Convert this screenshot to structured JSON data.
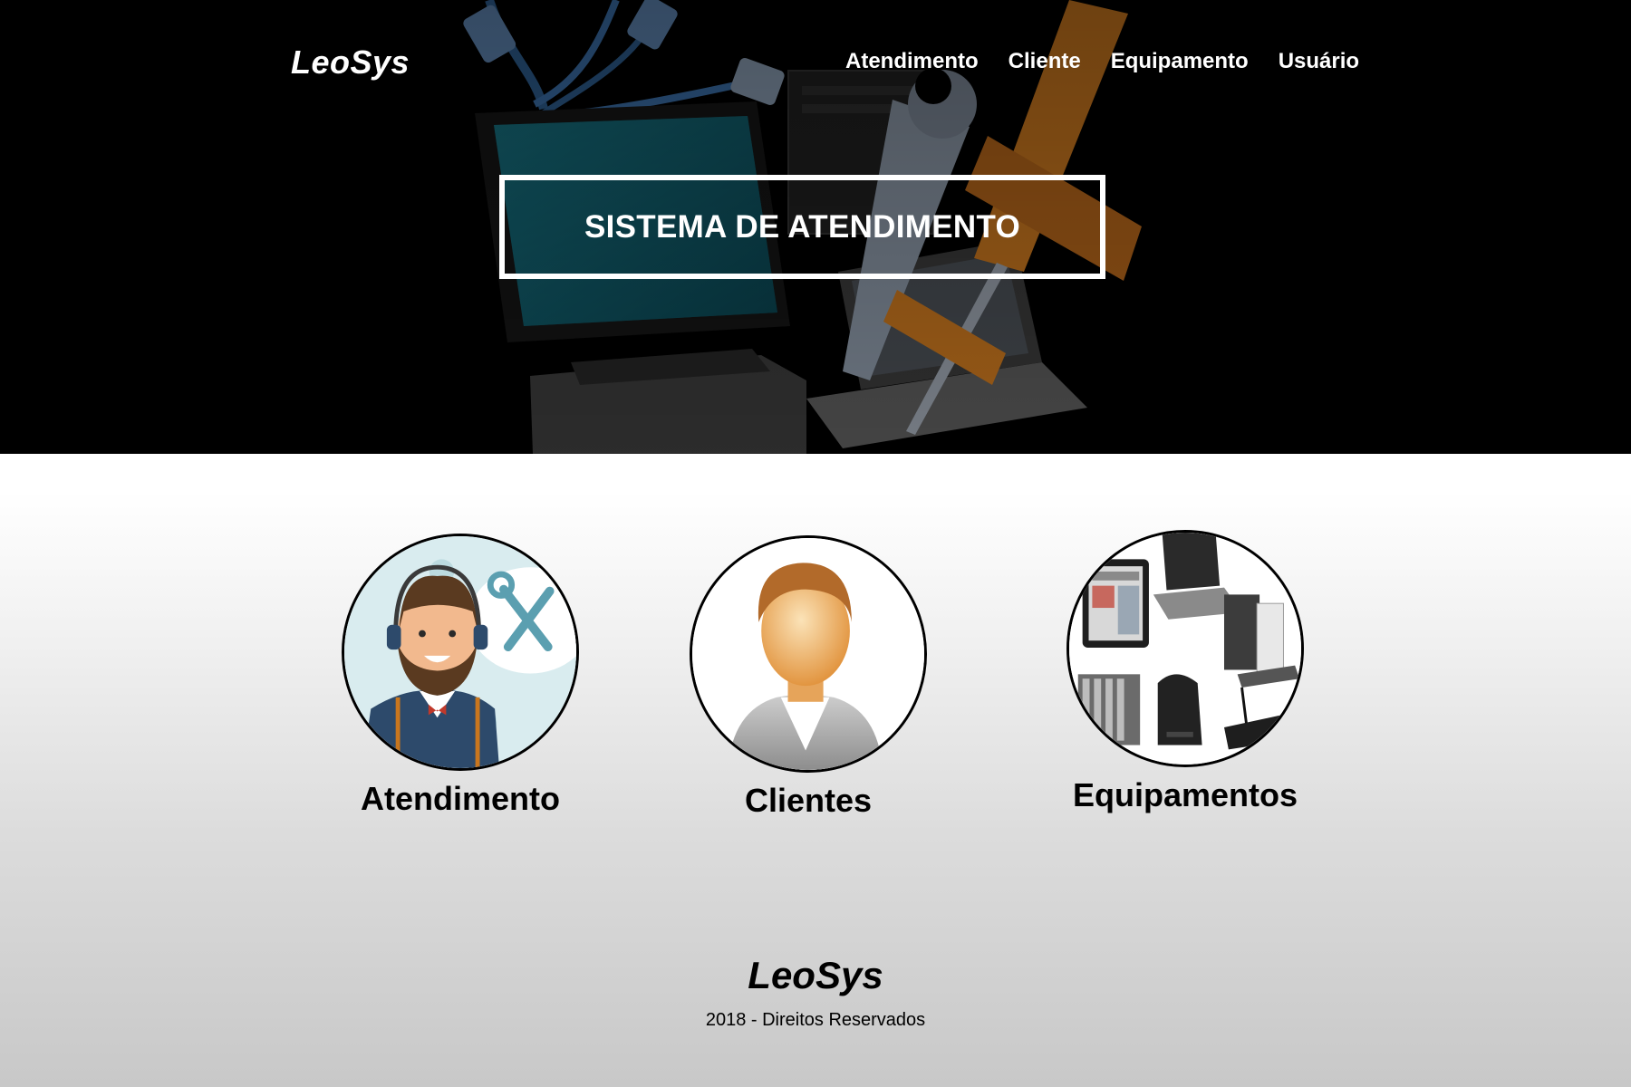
{
  "header": {
    "logo": "LeoSys",
    "nav": [
      {
        "label": "Atendimento"
      },
      {
        "label": "Cliente"
      },
      {
        "label": "Equipamento"
      },
      {
        "label": "Usuário"
      }
    ]
  },
  "hero": {
    "title": "SISTEMA DE ATENDIMENTO",
    "background_icon": "computer-repair-tools-image"
  },
  "cards": [
    {
      "label": "Atendimento",
      "icon": "support-agent-image"
    },
    {
      "label": "Clientes",
      "icon": "client-person-image"
    },
    {
      "label": "Equipamentos",
      "icon": "equipment-devices-image"
    }
  ],
  "footer": {
    "logo": "LeoSys",
    "copyright": "2018 - Direitos Reservados"
  },
  "colors": {
    "hero_background": "#000000",
    "accent_orange": "#c8761e",
    "accent_teal": "#0f5a6a"
  }
}
